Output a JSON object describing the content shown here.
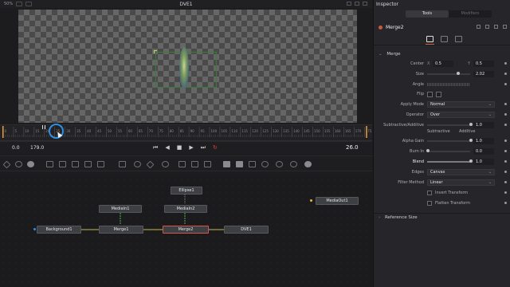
{
  "viewer": {
    "zoom": "50%",
    "title": "DVE1"
  },
  "timeline": {
    "ticks": [
      "0",
      "5",
      "10",
      "15",
      "20",
      "25",
      "30",
      "35",
      "40",
      "45",
      "50",
      "55",
      "60",
      "65",
      "70",
      "75",
      "80",
      "85",
      "90",
      "95",
      "100",
      "105",
      "110",
      "115",
      "120",
      "125",
      "130",
      "135",
      "140",
      "145",
      "150",
      "155",
      "160",
      "165",
      "170",
      "175"
    ],
    "start": "0.0",
    "end": "179.0",
    "current_frame": "26.0"
  },
  "nodes": {
    "ellipse": "Ellipse1",
    "mediain1": "MediaIn1",
    "mediain2": "MediaIn2",
    "mediaout": "MediaOut1",
    "background": "Background1",
    "merge1": "Merge1",
    "merge2": "Merge2",
    "dve": "DVE1"
  },
  "inspector": {
    "title": "Inspector",
    "tabs": [
      "Tools",
      "Modifiers"
    ],
    "active_tab": "Tools",
    "node_name": "Merge2",
    "section_merge": "Merge",
    "section_reference": "Reference Size",
    "props": {
      "center_label": "Center",
      "center_x_axis": "X",
      "center_x": "0.5",
      "center_y_axis": "Y",
      "center_y": "0.5",
      "size_label": "Size",
      "size": "2.02",
      "angle_label": "Angle",
      "flip_label": "Flip",
      "apply_mode_label": "Apply Mode",
      "apply_mode": "Normal",
      "operator_label": "Operator",
      "operator": "Over",
      "subadd_label": "Subtractive/Additive",
      "subadd": "1.0",
      "subtractive": "Subtractive",
      "additive": "Additive",
      "alpha_gain_label": "Alpha Gain",
      "alpha_gain": "1.0",
      "burn_in_label": "Burn In",
      "burn_in": "0.0",
      "blend_label": "Blend",
      "blend": "1.0",
      "edges_label": "Edges",
      "edges": "Canvas",
      "filter_label": "Filter Method",
      "filter": "Linear",
      "invert_label": "Invert Transform",
      "flatten_label": "Flatten Transform"
    }
  },
  "colors": {
    "accent": "#d6663a",
    "playhead_ring": "#2e8fe6",
    "selected_node": "#d4554c",
    "loop_icon": "#e2433a"
  }
}
